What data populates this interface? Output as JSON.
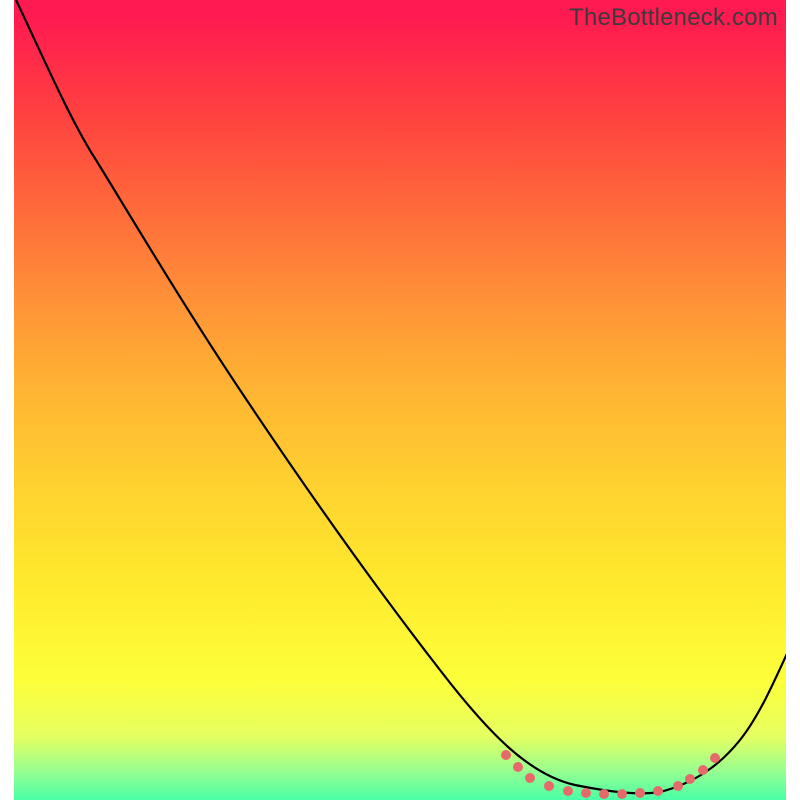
{
  "watermark": "TheBottleneck.com",
  "chart_data": {
    "type": "line",
    "title": "",
    "xlabel": "",
    "ylabel": "",
    "xlim": [
      0,
      100
    ],
    "ylim": [
      0,
      100
    ],
    "series": [
      {
        "name": "bottleneck-curve",
        "x": [
          2,
          6,
          10,
          14,
          18,
          22,
          26,
          30,
          34,
          38,
          42,
          46,
          50,
          54,
          58,
          62,
          66,
          70,
          74,
          78,
          82,
          86,
          90,
          94,
          100
        ],
        "y": [
          100,
          95,
          90,
          85,
          79,
          73,
          67,
          61,
          55,
          49,
          43,
          37,
          31,
          25,
          19,
          14,
          9,
          5,
          2,
          1,
          2,
          5,
          10,
          17,
          28
        ]
      }
    ],
    "dotted_region_x": [
      63,
      86
    ],
    "background_gradient_stops": [
      {
        "pos": 0,
        "color": "#ff1a51"
      },
      {
        "pos": 14,
        "color": "#ff4040"
      },
      {
        "pos": 26,
        "color": "#ff6a3b"
      },
      {
        "pos": 36,
        "color": "#ff8c38"
      },
      {
        "pos": 46,
        "color": "#ffad34"
      },
      {
        "pos": 60,
        "color": "#ffd030"
      },
      {
        "pos": 72,
        "color": "#ffe82d"
      },
      {
        "pos": 85,
        "color": "#fdff3a"
      },
      {
        "pos": 92,
        "color": "#e6ff60"
      },
      {
        "pos": 96,
        "color": "#9fff8c"
      },
      {
        "pos": 100,
        "color": "#49ffa8"
      }
    ]
  }
}
